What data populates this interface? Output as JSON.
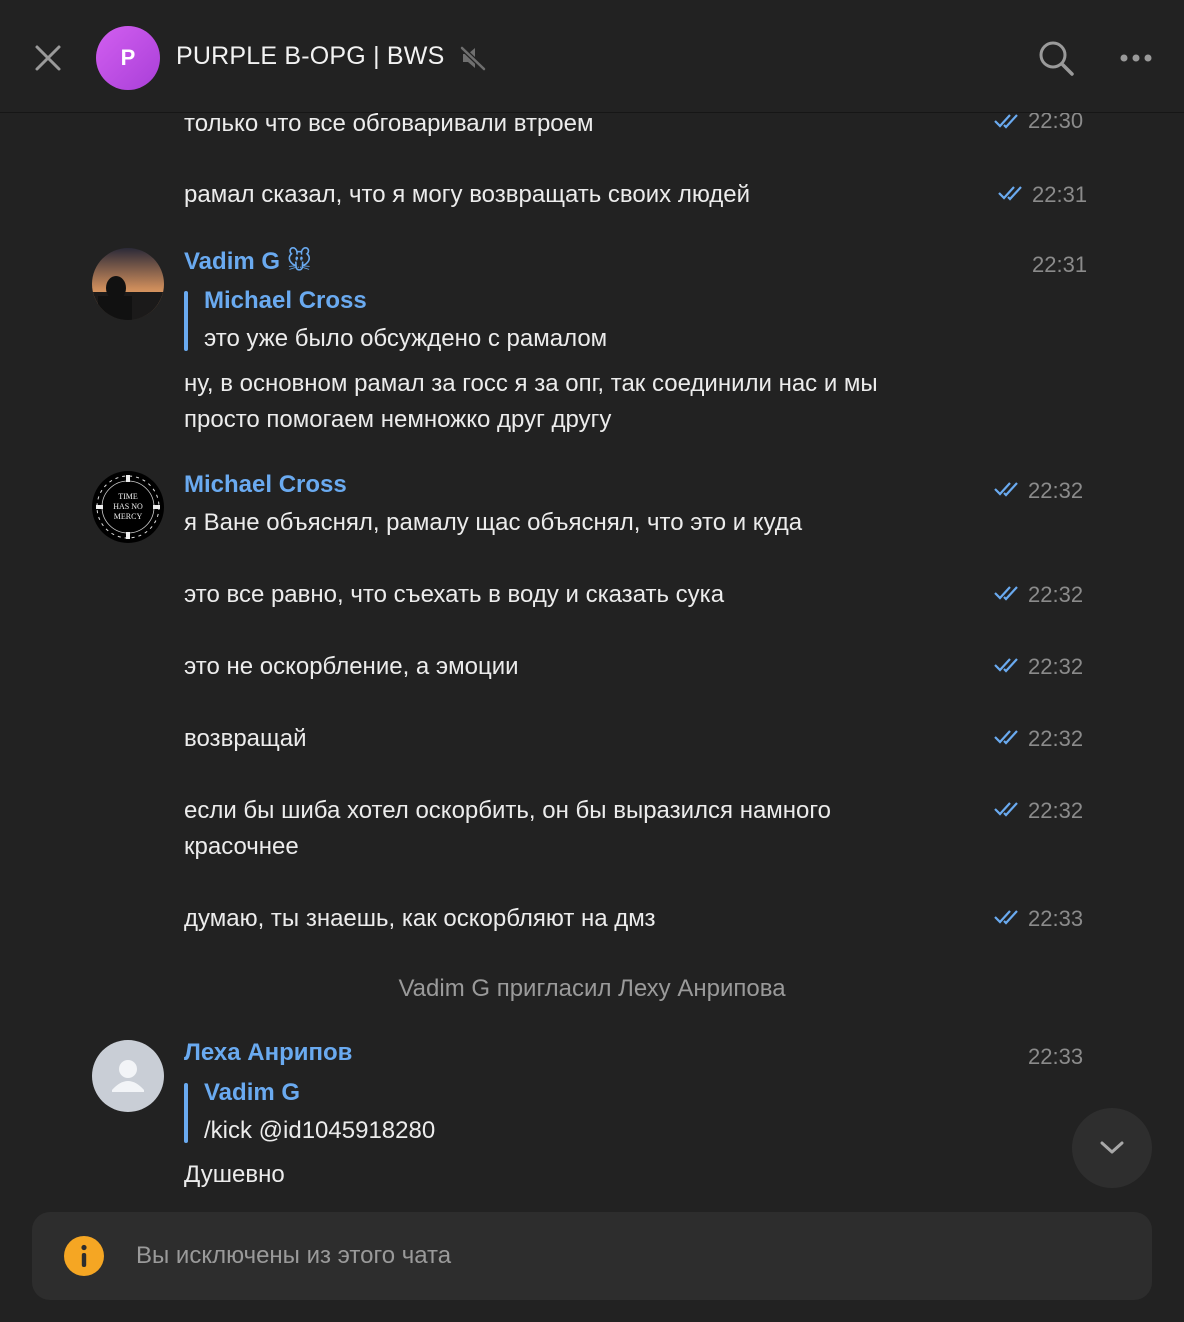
{
  "header": {
    "chat_title": "PURPLE B-OPG | BWS",
    "avatar_letter": "P",
    "avatar_color": "#c04fe6"
  },
  "messages": [
    {
      "text": "только что все обговаривали втроем",
      "time": "22:30"
    },
    {
      "text": "рамал сказал, что я могу возвращать своих людей",
      "time": "22:31"
    },
    {
      "sender": "Vadim G 🐭",
      "time": "22:31",
      "reply_to": {
        "name": "Michael Cross",
        "text": "это уже было обсуждено с рамалом"
      },
      "text_lines": [
        "ну, в основном рамал за госс я за опг, так соединили нас и мы",
        "просто помогаем немножко друг другу"
      ]
    },
    {
      "sender": "Michael Cross",
      "text": "я Ване объяснял, рамалу щас объяснял, что это и куда",
      "time": "22:32"
    },
    {
      "text": "это все равно, что съехать в воду и сказать сука",
      "time": "22:32"
    },
    {
      "text": "это не оскорбление, а эмоции",
      "time": "22:32"
    },
    {
      "text": "возвращай",
      "time": "22:32"
    },
    {
      "text_lines": [
        "если бы шиба хотел оскорбить, он бы выразился намного",
        "красочнее"
      ],
      "time": "22:32"
    },
    {
      "text": "думаю, ты знаешь, как оскорбляют на дмз",
      "time": "22:33"
    },
    {
      "sender": "Леха Анрипов",
      "time": "22:33",
      "reply_to": {
        "name": "Vadim G",
        "text": "/kick @id1045918280"
      },
      "text": "Душевно"
    }
  ],
  "service_message": "Vadim G пригласил Леху Анрипова",
  "michael_avatar_text": [
    "TIME",
    "HAS NO",
    "MERCY"
  ],
  "footer": {
    "notice": "Вы исключены из этого чата"
  },
  "colors": {
    "accent": "#6aaaf0",
    "background": "#222222",
    "warning": "#f5a623"
  }
}
